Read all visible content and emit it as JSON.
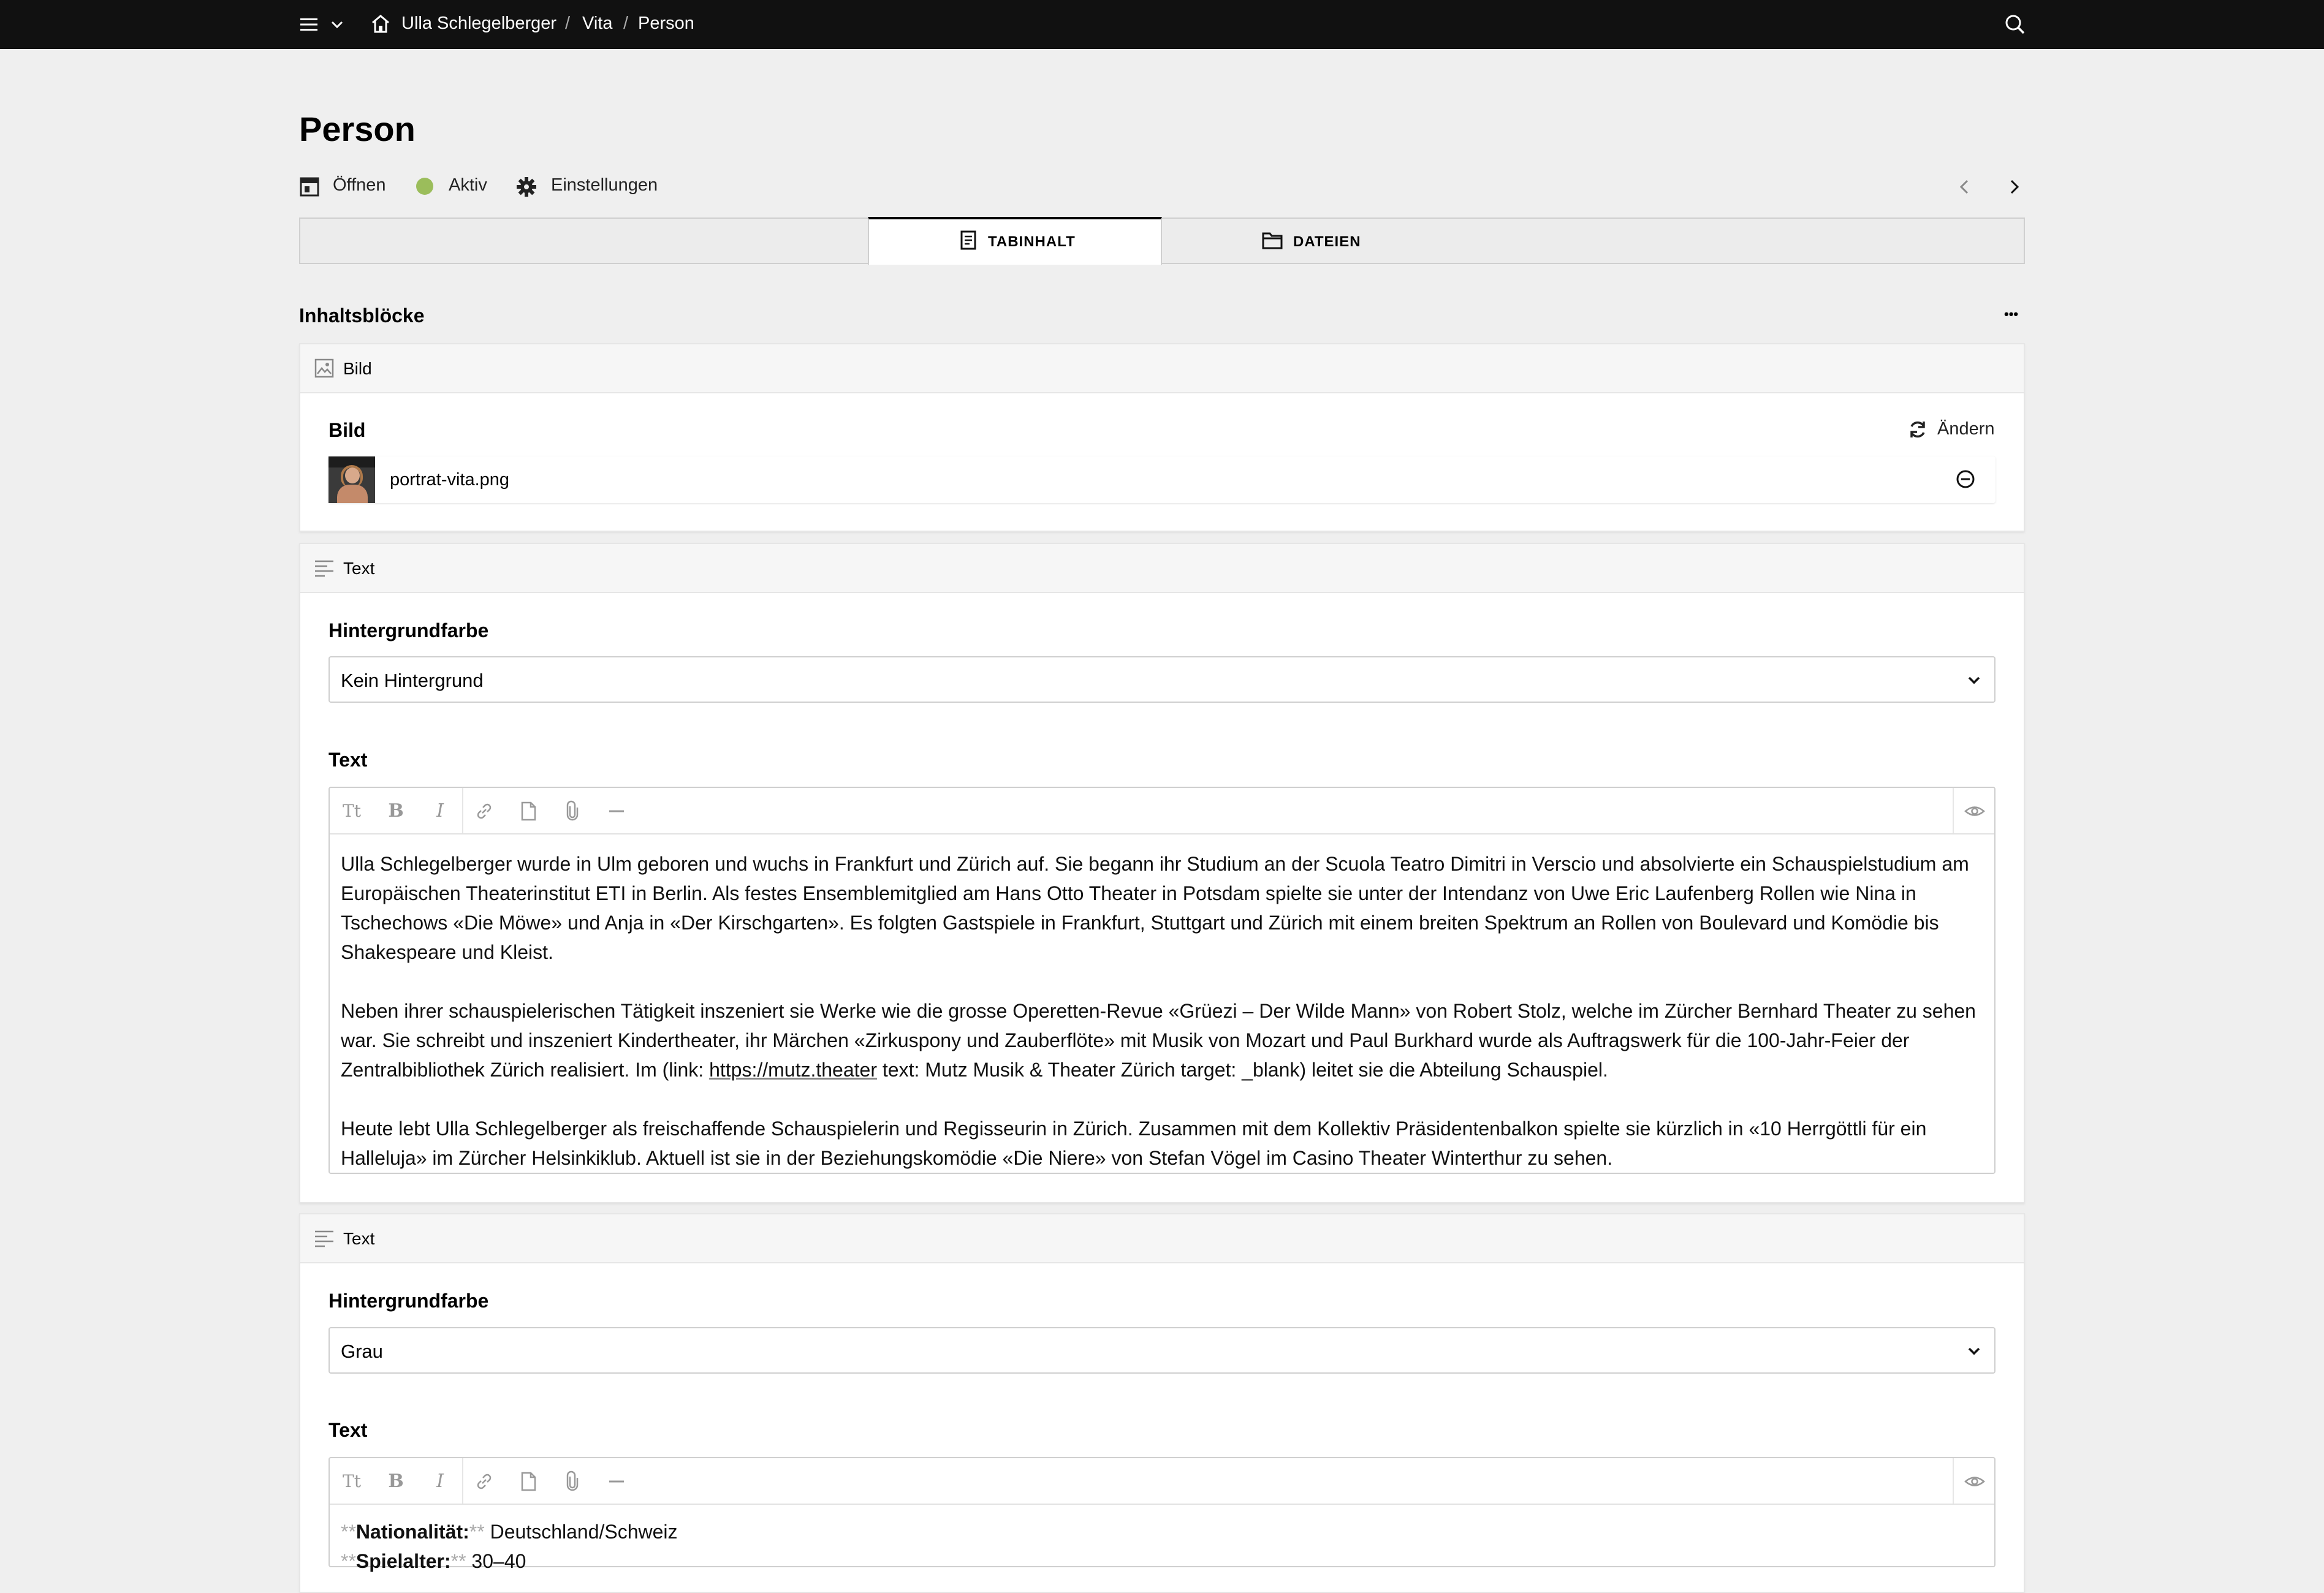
{
  "topbar": {
    "breadcrumb": [
      "Ulla Schlegelberger",
      "Vita",
      "Person"
    ],
    "separator": "/"
  },
  "header": {
    "title": "Person",
    "open_label": "Öffnen",
    "status_label": "Aktiv",
    "status_color": "#9bbd5b",
    "settings_label": "Einstellungen"
  },
  "tabs": [
    {
      "label": "TABINHALT",
      "active": true
    },
    {
      "label": "DATEIEN",
      "active": false
    }
  ],
  "section": {
    "title": "Inhaltsblöcke",
    "more": "•••"
  },
  "blocks": {
    "image": {
      "type_label": "Bild",
      "field_label": "Bild",
      "change_label": "Ändern",
      "file_name": "portrat-vita.png"
    },
    "text1": {
      "type_label": "Text",
      "bg_label": "Hintergrundfarbe",
      "bg_value": "Kein Hintergrund",
      "text_label": "Text",
      "p1": "Ulla Schlegelberger wurde in Ulm geboren und wuchs in Frankfurt und Zürich auf. Sie begann ihr Studium an der Scuola Teatro Dimitri in Verscio und absolvierte ein Schauspielstudium am Europäischen Theaterinstitut ETI in Berlin. Als festes Ensemblemitglied am Hans Otto Theater in Potsdam spielte sie unter der Intendanz von Uwe Eric Laufenberg Rollen wie Nina in Tschechows «Die Möwe» und Anja in «Der Kirschgarten». Es folgten Gastspiele in Frankfurt, Stuttgart und Zürich mit einem breiten Spektrum an Rollen von Boulevard und Komödie bis Shakespeare und Kleist.",
      "p2_pre": "Neben ihrer schauspielerischen Tätigkeit inszeniert sie Werke wie die grosse Operetten-Revue «Grüezi – Der Wilde Mann» von Robert Stolz, welche im Zürcher Bernhard Theater zu sehen war. Sie schreibt und inszeniert Kindertheater, ihr Märchen «Zirkuspony und Zauberflöte» mit Musik von Mozart und Paul Burkhard wurde als Auftragswerk für die 100-Jahr-Feier der Zentralbibliothek Zürich realisiert. Im (link: ",
      "p2_link": "https://mutz.theater",
      "p2_post": " text: Mutz Musik & Theater Zürich target: _blank) leitet sie die Abteilung Schauspiel.",
      "p3": "Heute lebt Ulla Schlegelberger als freischaffende Schauspielerin und Regisseurin in Zürich. Zusammen mit dem Kollektiv Präsidentenbalkon spielte sie kürzlich in «10 Herrgöttli für ein Halleluja» im Zürcher Helsinkiklub. Aktuell ist sie in der Beziehungskomödie «Die Niere» von Stefan Vögel im Casino Theater Winterthur zu sehen."
    },
    "text2": {
      "type_label": "Text",
      "bg_label": "Hintergrundfarbe",
      "bg_value": "Grau",
      "text_label": "Text",
      "md": "**",
      "line1_key": "Nationalität:",
      "line1_val": " Deutschland/Schweiz",
      "line2_key": "Spielalter:",
      "line2_val": " 30–40"
    }
  }
}
